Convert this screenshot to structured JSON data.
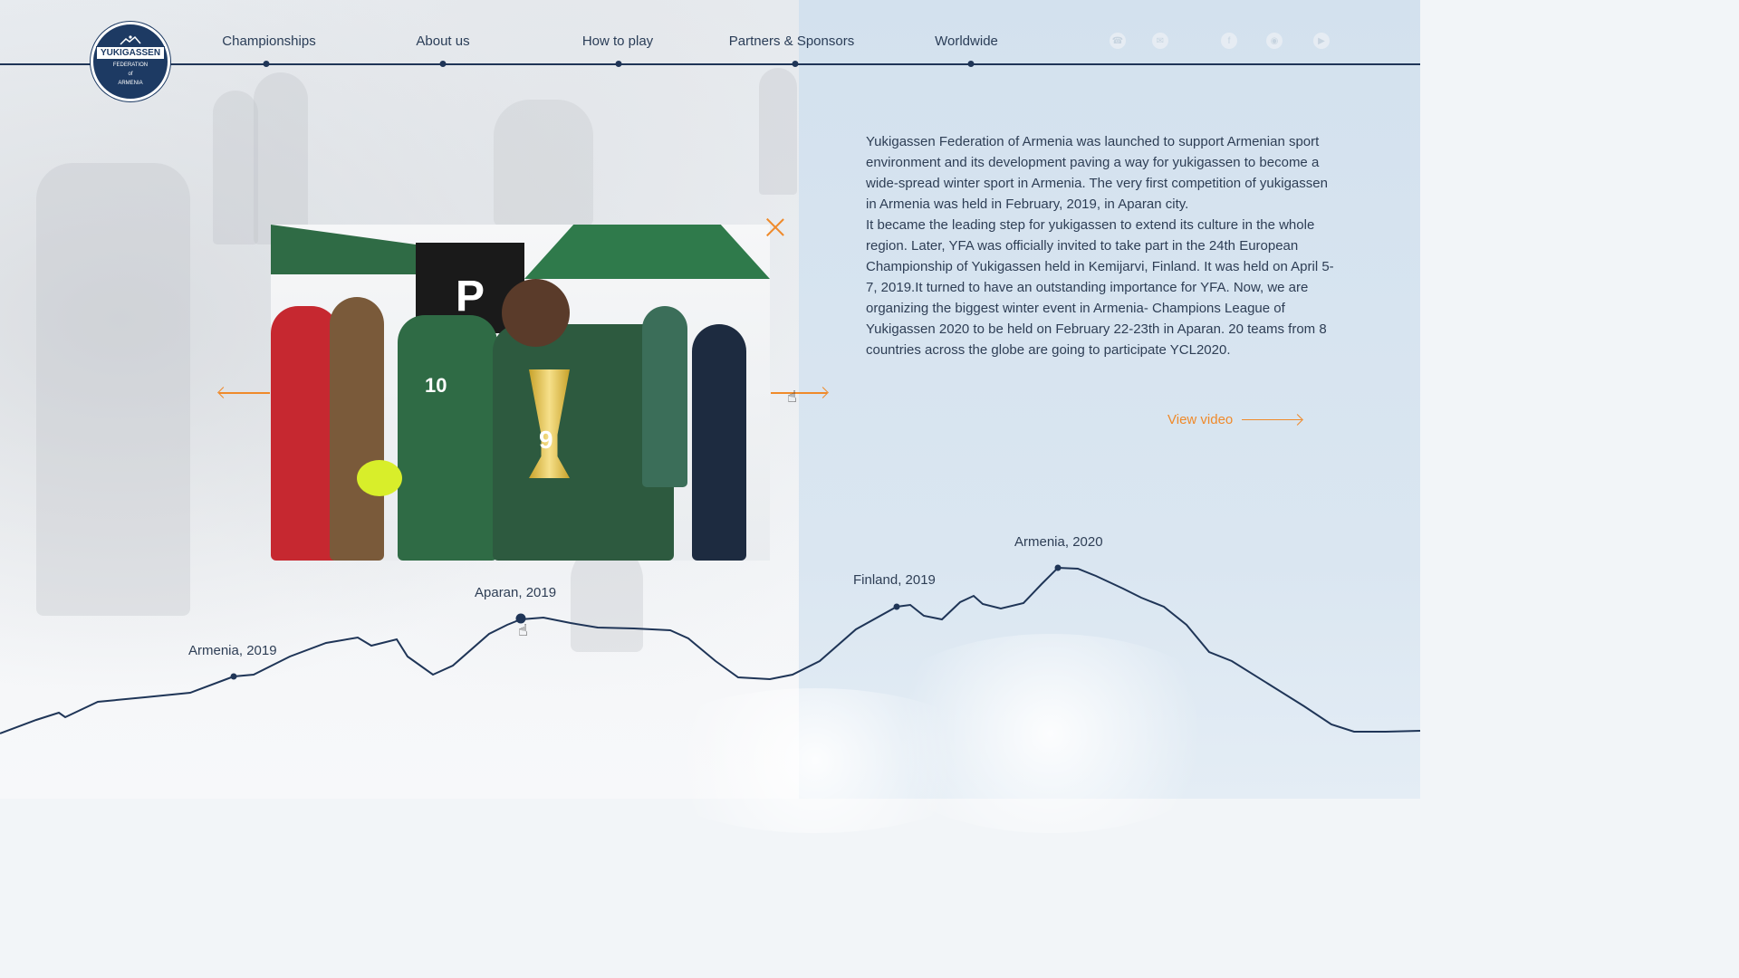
{
  "brand": {
    "logo_title": "YUKIGASSEN",
    "logo_subtitle": [
      "FEDERATION",
      "of",
      "ARMENIA"
    ]
  },
  "nav": {
    "items": [
      {
        "label": "Championships"
      },
      {
        "label": "About us"
      },
      {
        "label": "How to play"
      },
      {
        "label": "Partners & Sponsors"
      },
      {
        "label": "Worldwide"
      }
    ]
  },
  "social": {
    "icons": [
      "phone-icon",
      "mail-icon",
      "facebook-icon",
      "instagram-icon",
      "youtube-icon"
    ]
  },
  "about": {
    "paragraphs": [
      "Yukigassen Federation of Armenia was launched to support Armenian sport environment and its development paving a way for yukigassen to become a wide-spread winter sport in Armenia. The very first competition of yukigassen in Armenia was held in February, 2019, in Aparan city.",
      "It became the leading step for yukigassen to extend its culture in the whole region. Later, YFA was officially invited to take part in the 24th European Championship of Yukigassen held in Kemijarvi, Finland. It was held on April 5-7, 2019.It turned to have an outstanding importance for YFA. Now, we are organizing the biggest winter event in Armenia- Champions League of Yukigassen 2020 to be held on February 22-23th in Aparan. 20 teams from 8 countries across the globe are going to participate YCL2020."
    ],
    "view_video": "View video"
  },
  "gallery": {
    "bib_numbers": [
      "10",
      "9"
    ],
    "board_letter": "P"
  },
  "timeline": {
    "events": [
      {
        "label": "Armenia, 2019"
      },
      {
        "label": "Aparan, 2019"
      },
      {
        "label": "Finland, 2019"
      },
      {
        "label": "Armenia, 2020"
      }
    ]
  },
  "colors": {
    "accent": "#ef8a2a",
    "navy": "#1f3557",
    "text": "#2e3e55"
  }
}
